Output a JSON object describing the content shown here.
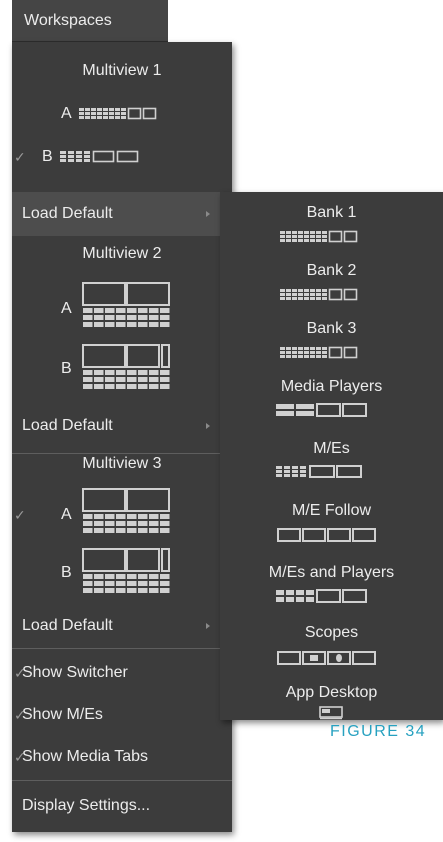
{
  "workspaces_button": "Workspaces",
  "menu": {
    "multiview1": {
      "title": "Multiview 1",
      "a_label": "A",
      "b_label": "B",
      "load_default": "Load Default"
    },
    "multiview2": {
      "title": "Multiview 2",
      "a_label": "A",
      "b_label": "B",
      "load_default": "Load Default"
    },
    "multiview3": {
      "title": "Multiview 3",
      "a_label": "A",
      "b_label": "B",
      "load_default": "Load Default"
    },
    "show_switcher": "Show Switcher",
    "show_mes": "Show M/Es",
    "show_media_tabs": "Show Media Tabs",
    "display_settings": "Display Settings...",
    "check_glyph": "✓"
  },
  "submenu": {
    "items": [
      {
        "label": "Bank 1",
        "icon": "layout-bank-icon"
      },
      {
        "label": "Bank 2",
        "icon": "layout-bank-icon"
      },
      {
        "label": "Bank 3",
        "icon": "layout-bank-icon"
      },
      {
        "label": "Media Players",
        "icon": "layout-media-players-icon"
      },
      {
        "label": "M/Es",
        "icon": "layout-mes-icon"
      },
      {
        "label": "M/E Follow",
        "icon": "layout-me-follow-icon"
      },
      {
        "label": "M/Es and Players",
        "icon": "layout-mes-players-icon"
      },
      {
        "label": "Scopes",
        "icon": "layout-scopes-icon"
      },
      {
        "label": "App Desktop",
        "icon": "layout-app-desktop-icon"
      }
    ]
  },
  "figure_caption": "FIGURE 34",
  "colors": {
    "menu_bg": "#3c3c3c",
    "highlight": "#4d4d4d",
    "text": "#ececec",
    "caption": "#27a1c0"
  }
}
